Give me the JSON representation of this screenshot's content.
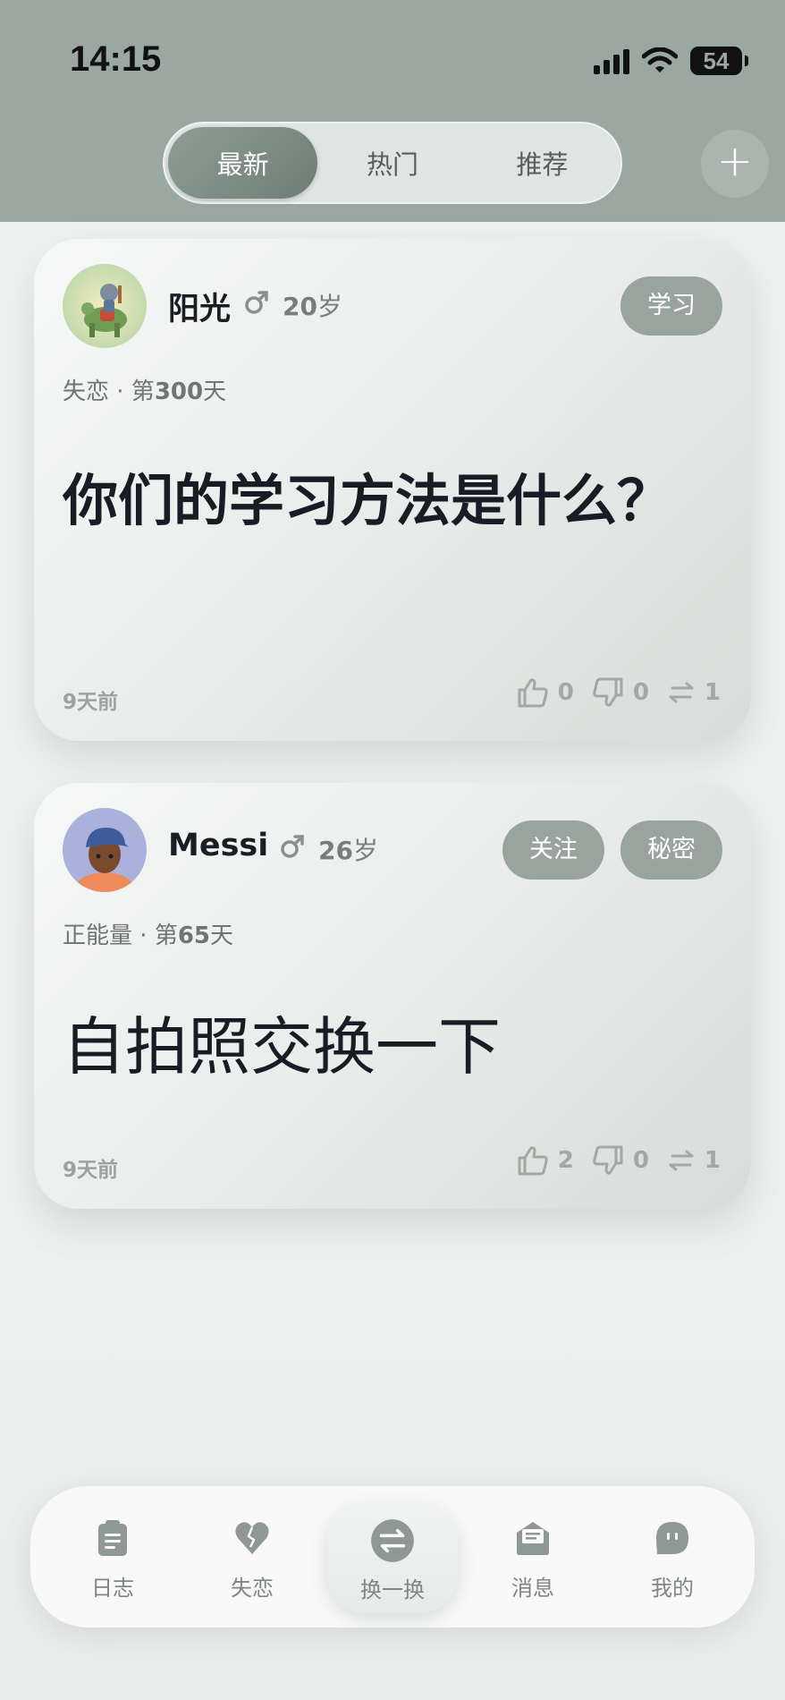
{
  "status_bar": {
    "time": "14:15",
    "battery": "54"
  },
  "header": {
    "tabs": [
      {
        "label": "最新",
        "active": true
      },
      {
        "label": "热门",
        "active": false
      },
      {
        "label": "推荐",
        "active": false
      }
    ],
    "add_icon": "plus-icon",
    "add_label": "+"
  },
  "posts": [
    {
      "user": {
        "name": "阳光",
        "age": "20",
        "age_unit": "岁",
        "gender": "male"
      },
      "tags": [
        "学习"
      ],
      "topic": "失恋",
      "day_prefix": "第",
      "day_count": "300",
      "day_suffix": "天",
      "content": "你们的学习方法是什么？",
      "time_ago": "9天前",
      "likes": "0",
      "dislikes": "0",
      "shares": "1"
    },
    {
      "user": {
        "name": "Messi",
        "age": "26",
        "age_unit": "岁",
        "gender": "male"
      },
      "tags": [
        "关注",
        "秘密"
      ],
      "topic": "正能量",
      "day_prefix": "第",
      "day_count": "65",
      "day_suffix": "天",
      "content": "自拍照交换一下",
      "time_ago": "9天前",
      "likes": "2",
      "dislikes": "0",
      "shares": "1"
    }
  ],
  "tabbar": {
    "items": [
      {
        "label": "日志",
        "icon": "clipboard-icon"
      },
      {
        "label": "失恋",
        "icon": "broken-heart-icon"
      },
      {
        "label": "换一换",
        "icon": "swap-icon",
        "active": true
      },
      {
        "label": "消息",
        "icon": "message-icon"
      },
      {
        "label": "我的",
        "icon": "profile-icon"
      }
    ]
  },
  "colors": {
    "header_bg": "#9ba8a1",
    "accent": "#7f8d86",
    "tag_bg": "#9aa49f",
    "text_dark": "#1b1d24"
  }
}
